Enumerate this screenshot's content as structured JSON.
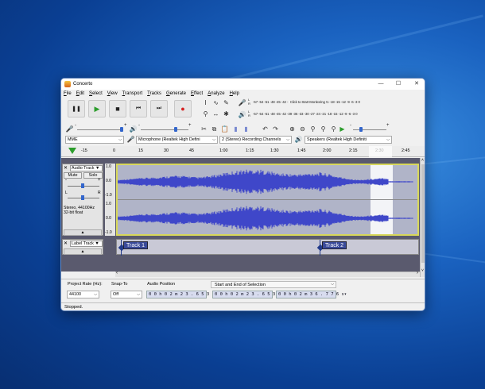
{
  "window": {
    "title": "Concerto",
    "minimize": "—",
    "maximize": "☐",
    "close": "✕"
  },
  "menu": [
    "File",
    "Edit",
    "Select",
    "View",
    "Transport",
    "Tracks",
    "Generate",
    "Effect",
    "Analyze",
    "Help"
  ],
  "transport": {
    "pause": "❚❚",
    "play": "▶",
    "stop": "■",
    "skip_start": "⏮",
    "skip_end": "⏭",
    "record": "●"
  },
  "meters": {
    "record_scale": "-57 -54 -51 -48 -45 -42 - Click to Start Monitoring !1 -18 -15 -12  -9  -6  -3  0",
    "play_scale": "-57 -54 -51 -48 -45 -42 -39 -36 -33 -30 -27 -24 -21 -18 -15 -12  -9  -6  -3  0",
    "lr_top": "L\nR",
    "lr_bottom": "L\nR"
  },
  "sliders": {
    "rec_minus": "-",
    "rec_plus": "+",
    "play_minus": "-",
    "play_plus": "+",
    "speed_minus": "-",
    "speed_plus": "+"
  },
  "devices": {
    "host": "MME",
    "recording": "Microphone (Realtek High Defini",
    "channels": "2 (Stereo) Recording Channels",
    "playback": "Speakers (Realtek High Definiti"
  },
  "ruler": {
    "ticks": [
      "-15",
      "0",
      "15",
      "30",
      "45",
      "1:00",
      "1:15",
      "1:30",
      "1:45",
      "2:00",
      "2:15",
      "2:30",
      "2:45"
    ]
  },
  "audio_track": {
    "name": "Audio Track",
    "mute": "Mute",
    "solo": "Solo",
    "info_line1": "Stereo, 44100Hz",
    "info_line2": "32-bit float",
    "gain_minus": "-",
    "gain_plus": "+",
    "pan_left": "L",
    "pan_right": "R",
    "scale_top": "1.0",
    "scale_mid": "0.0",
    "scale_bottom": "-1.0"
  },
  "label_track": {
    "name": "Label Track",
    "labels": [
      "Track 1",
      "Track 2"
    ]
  },
  "selection_toolbar": {
    "project_rate_label": "Project Rate (Hz):",
    "project_rate": "44100",
    "snap_to_label": "Snap-To",
    "snap_to": "Off",
    "audio_position_label": "Audio Position",
    "audio_position": "0 0 h 0 2 m 2 3 . 6 5 3 s",
    "selection_label": "Start and End of Selection",
    "selection_start": "0 0 h 0 2 m 2 3 . 6 5 3 s",
    "selection_end": "0 0 h 0 2 m 3 6 . 7 7 6 s"
  },
  "status": "Stopped."
}
